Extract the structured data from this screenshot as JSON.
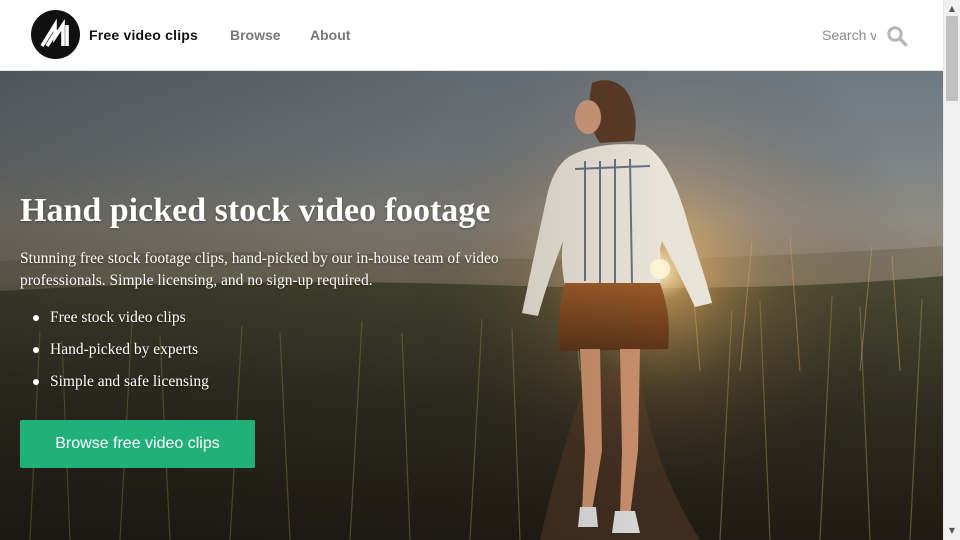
{
  "header": {
    "brand": "Free video clips",
    "nav": {
      "browse": "Browse",
      "about": "About"
    },
    "search": {
      "placeholder": "Search videos",
      "value": ""
    }
  },
  "hero": {
    "title": "Hand picked stock video footage",
    "description": "Stunning free stock footage clips, hand-picked by our in-house team of video professionals. Simple licensing, and no sign-up required.",
    "features": [
      "Free stock video clips",
      "Hand-picked by experts",
      "Simple and safe licensing"
    ],
    "cta_label": "Browse free video clips"
  },
  "icons": {
    "logo": "mixkit-logo-icon",
    "search": "search-icon",
    "scroll_up": "scroll-up-arrow-icon",
    "scroll_down": "scroll-down-arrow-icon"
  },
  "colors": {
    "accent": "#22b07a",
    "header_bg": "#ffffff",
    "nav_text": "#777777",
    "brand_text": "#111111",
    "logo_bg": "#111111"
  }
}
